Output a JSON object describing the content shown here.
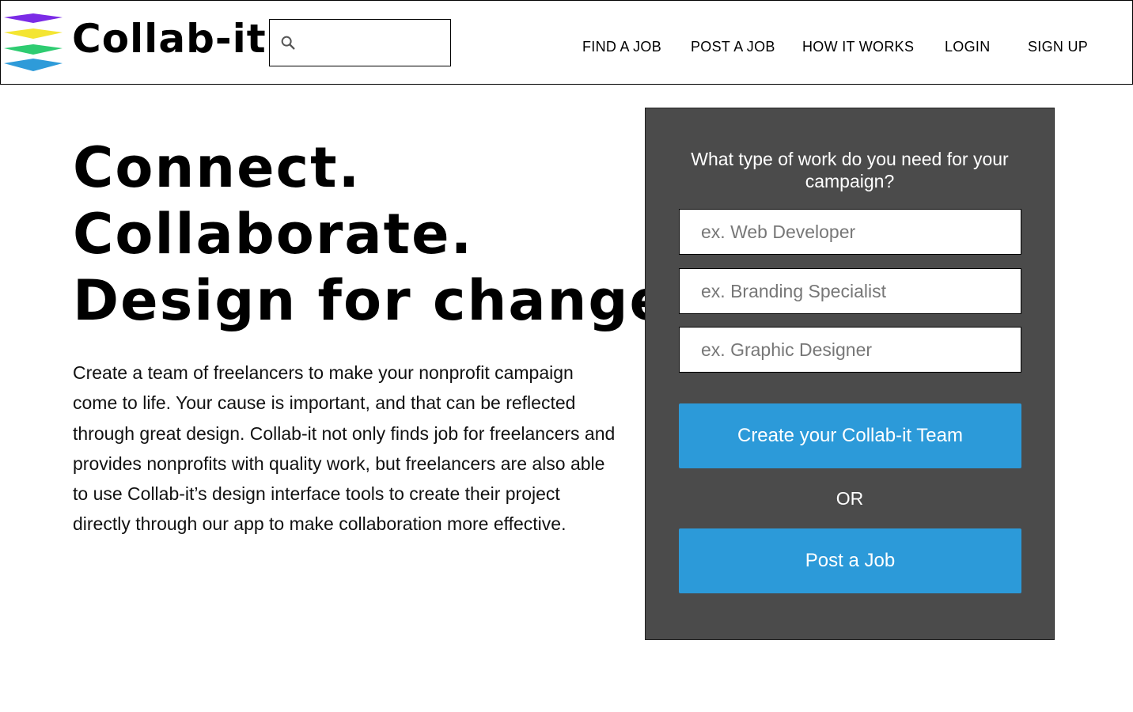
{
  "header": {
    "brand": "Collab-it",
    "logo_colors": [
      "#7b2be6",
      "#f4e532",
      "#2ecc71",
      "#2e9bd9"
    ],
    "search": {
      "placeholder": "",
      "value": "",
      "icon": "search-icon"
    },
    "nav": [
      {
        "label": "FIND A JOB"
      },
      {
        "label": "POST A JOB"
      },
      {
        "label": "HOW IT WORKS"
      },
      {
        "label": "LOGIN"
      },
      {
        "label": "SIGN UP"
      }
    ]
  },
  "hero": {
    "lines": [
      "Connect.",
      "Collaborate.",
      "Design for change."
    ],
    "description": "Create a team of freelancers to make your nonprofit campaign come to life. Your cause is important, and that can be reflected through great design. Collab-it not only finds job for freelancers and provides nonprofits with quality work, but freelancers are also able to use Collab-it’s design interface tools to create their project directly through our app to make collaboration more effective."
  },
  "panel": {
    "question": "What type of work do you need for your campaign?",
    "fields": [
      {
        "placeholder": "ex. Web Developer",
        "value": ""
      },
      {
        "placeholder": "ex. Branding Specialist",
        "value": ""
      },
      {
        "placeholder": "ex. Graphic Designer",
        "value": ""
      }
    ],
    "create_button": "Create your Collab-it Team",
    "or_text": "OR",
    "post_button": "Post a Job",
    "colors": {
      "panel_bg": "#4b4b4b",
      "button_bg": "#2c9ad9"
    }
  }
}
